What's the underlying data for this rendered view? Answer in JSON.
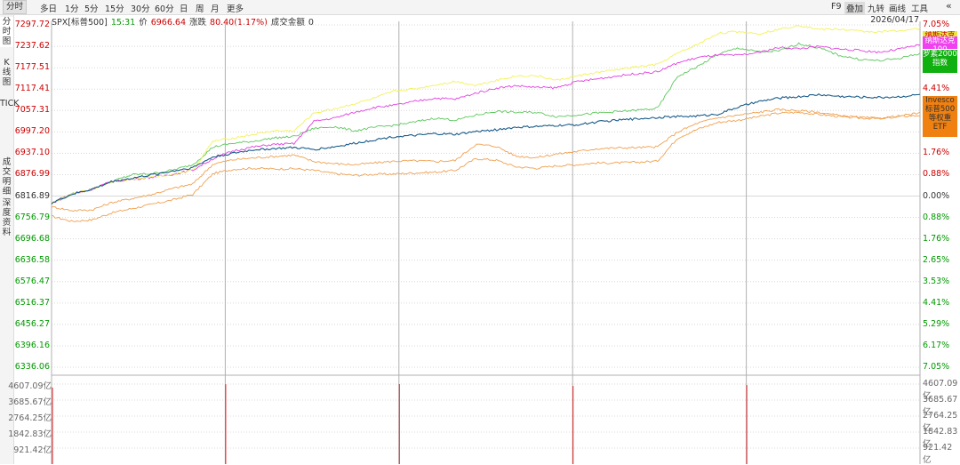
{
  "toolbar": {
    "tabs": [
      "分时",
      "多日",
      "1分",
      "5分",
      "15分",
      "30分",
      "60分",
      "日",
      "周",
      "月",
      "更多"
    ],
    "right_tabs": [
      "F9",
      "叠加",
      "九转",
      "画线",
      "工具"
    ],
    "collapse_icon": "double-chevron-left-icon"
  },
  "sidebar": {
    "items": [
      "分时图",
      "K线图",
      "TICK",
      "成交明细",
      "深度资料"
    ]
  },
  "info": {
    "symbol": "SPX[标普500]",
    "time": "15:31",
    "price_label": "价",
    "price": "6966.64",
    "change_label": "涨跌",
    "change": "80.40(1.17%)",
    "turnover_label": "成交金额",
    "turnover": "0",
    "date": "2026/04/17"
  },
  "colors": {
    "up": "#cc0000",
    "down": "#009900",
    "neutral": "#333333",
    "grid": "#d8d8d8",
    "separator": "#b0b0b0",
    "volume_bar": "#e02020",
    "series_spx": "#1a5c8a",
    "series_nasdaq": "#f2f25a",
    "series_dow": "#e040e0",
    "series_russell": "#5cc85c",
    "series_rsp": "#f0a050"
  },
  "chart_data": {
    "type": "line",
    "title": "",
    "y_left_ticks": [
      "7297.72",
      "7237.62",
      "7177.51",
      "7117.41",
      "7057.31",
      "6997.20",
      "6937.10",
      "6876.99",
      "6816.89",
      "6756.79",
      "6696.68",
      "6636.58",
      "6576.47",
      "6516.37",
      "6456.27",
      "6396.16",
      "6336.06"
    ],
    "y_right_ticks": [
      "7.05%",
      "6.17%",
      "5.29%",
      "4.41%",
      "3.53%",
      "2.65%",
      "1.76%",
      "0.88%",
      "0.00%",
      "0.88%",
      "1.76%",
      "2.65%",
      "3.53%",
      "4.41%",
      "5.29%",
      "6.17%",
      "7.05%"
    ],
    "ylim": [
      6336.06,
      7297.72
    ],
    "base_value": 6816.89,
    "days": 5,
    "legend": [
      {
        "name": "纳斯达克100",
        "color": "#e8e840",
        "text_color": "#333333"
      },
      {
        "name": "纳斯达克100",
        "color": "#f040f0",
        "text_color": "#ffffff"
      },
      {
        "name": "罗素2000指数",
        "color": "#10b010",
        "text_color": "#ffffff"
      },
      {
        "name": "Invesco标普500等权重ETF",
        "color": "#f08010",
        "text_color": "#333333"
      }
    ],
    "series": [
      {
        "key": "spx",
        "color": "#1a5c8a",
        "values": [
          6797,
          6822,
          6836,
          6858,
          6867,
          6877,
          6887,
          6897,
          6927,
          6937,
          6947,
          6950,
          6953,
          6948,
          6955,
          6965,
          6975,
          6984,
          6987,
          6992,
          6990,
          6998,
          7003,
          7010,
          7012,
          7015,
          7017,
          7025,
          7030,
          7034,
          7038,
          7040,
          7042,
          7047,
          7067,
          7082,
          7092,
          7096,
          7102,
          7097,
          7095,
          7094,
          7096,
          7102
        ]
      },
      {
        "key": "nasdaq",
        "color": "#f2f25a",
        "values": [
          6797,
          6822,
          6836,
          6858,
          6864,
          6870,
          6878,
          6890,
          6971,
          6980,
          6990,
          7000,
          7000,
          7050,
          7062,
          7076,
          7092,
          7112,
          7118,
          7129,
          7139,
          7128,
          7142,
          7154,
          7155,
          7142,
          7154,
          7164,
          7172,
          7180,
          7186,
          7218,
          7243,
          7274,
          7279,
          7273,
          7285,
          7297,
          7285,
          7286,
          7280,
          7278,
          7282,
          7287
        ]
      },
      {
        "key": "dow",
        "color": "#e040e0",
        "values": [
          6797,
          6822,
          6836,
          6858,
          6864,
          6870,
          6878,
          6890,
          6922,
          6944,
          6955,
          6962,
          6964,
          7027,
          7036,
          7052,
          7066,
          7072,
          7083,
          7092,
          7089,
          7106,
          7120,
          7127,
          7122,
          7121,
          7138,
          7146,
          7154,
          7161,
          7166,
          7191,
          7206,
          7213,
          7212,
          7220,
          7234,
          7231,
          7237,
          7230,
          7226,
          7221,
          7230,
          7242
        ]
      },
      {
        "key": "russell",
        "color": "#5cc85c",
        "values": [
          6797,
          6822,
          6836,
          6858,
          6877,
          6880,
          6890,
          6905,
          6955,
          6965,
          6971,
          6980,
          6984,
          7007,
          7012,
          7000,
          7010,
          7016,
          7025,
          7036,
          7030,
          7044,
          7055,
          7052,
          7052,
          7040,
          7045,
          7050,
          7054,
          7058,
          7063,
          7153,
          7181,
          7215,
          7233,
          7222,
          7224,
          7245,
          7233,
          7212,
          7201,
          7197,
          7204,
          7218
        ]
      },
      {
        "key": "rsp",
        "color": "#f0a050",
        "values": [
          6787,
          6776,
          6778,
          6799,
          6810,
          6822,
          6838,
          6851,
          6907,
          6919,
          6924,
          6928,
          6932,
          6914,
          6908,
          6905,
          6910,
          6915,
          6916,
          6914,
          6917,
          6962,
          6957,
          6929,
          6925,
          6935,
          6942,
          6950,
          6952,
          6953,
          6955,
          6997,
          7022,
          7037,
          7044,
          7052,
          7060,
          7057,
          7052,
          7043,
          7038,
          7035,
          7042,
          7050
        ]
      },
      {
        "key": "rsp2",
        "color": "#f0a050",
        "values": [
          6760,
          6746,
          6750,
          6770,
          6782,
          6794,
          6806,
          6822,
          6880,
          6892,
          6895,
          6893,
          6894,
          6889,
          6880,
          6875,
          6878,
          6879,
          6882,
          6884,
          6889,
          6922,
          6918,
          6899,
          6895,
          6902,
          6905,
          6910,
          6910,
          6912,
          6915,
          6980,
          7005,
          7024,
          7030,
          7040,
          7050,
          7052,
          7046,
          7040,
          7036,
          7034,
          7040,
          7044
        ]
      }
    ],
    "volume": {
      "ticks": [
        "4607.09亿",
        "3685.67亿",
        "2764.25亿",
        "1842.83亿",
        "921.42亿"
      ],
      "ylim": [
        0,
        4607.09
      ],
      "spikes": [
        {
          "day": 1,
          "value": 4400
        },
        {
          "day": 2,
          "value": 4600
        },
        {
          "day": 3,
          "value": 4750
        },
        {
          "day": 4,
          "value": 4500
        },
        {
          "day": 5,
          "value": 4550
        }
      ]
    }
  }
}
